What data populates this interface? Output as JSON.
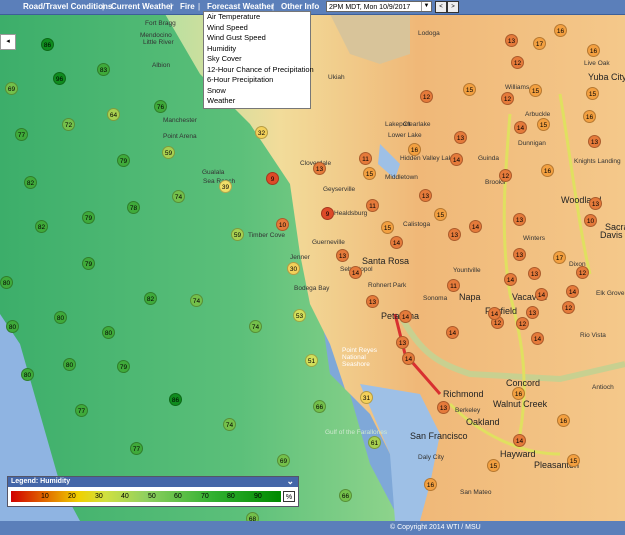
{
  "nav": {
    "items": [
      "Road/Travel Conditions",
      "Current Weather",
      "Fire",
      "Forecast Weather",
      "Other Info"
    ],
    "separator": "|"
  },
  "time_select": {
    "value": "2PM MDT, Mon 10/9/2017",
    "prev_label": "<",
    "next_label": ">"
  },
  "forecast_menu": {
    "items": [
      "Air Temperature",
      "Wind Speed",
      "Wind Gust Speed",
      "Humidity",
      "Sky Cover",
      "12-Hour Chance of Precipitation",
      "6-Hour Precipitation",
      "Snow",
      "Weather"
    ]
  },
  "map_button_label": "◂",
  "places": [
    "Fort Bragg",
    "Mendocino",
    "Little River",
    "Albion",
    "Manchester",
    "Point Arena",
    "Gualala",
    "Sea Ranch",
    "Timber Cove",
    "Jenner",
    "Bodega Bay",
    "Point Reyes National Seashore",
    "Gulf of the Farallones",
    "Cloverdale",
    "Geyserville",
    "Healdsburg",
    "Guerneville",
    "Santa Rosa",
    "Sebastopol",
    "Rohnert Park",
    "Petaluma",
    "Sonoma",
    "Napa",
    "Yountville",
    "Calistoga",
    "Middletown",
    "Lakeport",
    "Clearlake",
    "Lower Lake",
    "Hidden Valley Lake",
    "Ukiah",
    "Lodoga",
    "Williams",
    "Arbuckle",
    "Yuba City",
    "Live Oak",
    "Dunnigan",
    "Guinda",
    "Brooks",
    "Knights Landing",
    "Woodland",
    "Davis",
    "Winters",
    "Vacaville",
    "Dixon",
    "Fairfield",
    "Rio Vista",
    "Concord",
    "Walnut Creek",
    "Richmond",
    "Berkeley",
    "Oakland",
    "San Francisco",
    "Daly City",
    "Hayward",
    "Pleasanton",
    "San Mateo",
    "Sacramento",
    "Elk Grove",
    "Antioch"
  ],
  "markers": [
    {
      "v": "86"
    },
    {
      "v": "96"
    },
    {
      "v": "69"
    },
    {
      "v": "83"
    },
    {
      "v": "77"
    },
    {
      "v": "72"
    },
    {
      "v": "64"
    },
    {
      "v": "76"
    },
    {
      "v": "82"
    },
    {
      "v": "79"
    },
    {
      "v": "59"
    },
    {
      "v": "74"
    },
    {
      "v": "82"
    },
    {
      "v": "79"
    },
    {
      "v": "78"
    },
    {
      "v": "80"
    },
    {
      "v": "82"
    },
    {
      "v": "79"
    },
    {
      "v": "80"
    },
    {
      "v": "74"
    },
    {
      "v": "80"
    },
    {
      "v": "80"
    },
    {
      "v": "77"
    },
    {
      "v": "79"
    },
    {
      "v": "80"
    },
    {
      "v": "74"
    },
    {
      "v": "80"
    },
    {
      "v": "77"
    },
    {
      "v": "74"
    },
    {
      "v": "86"
    },
    {
      "v": "66"
    },
    {
      "v": "69"
    },
    {
      "v": "68"
    },
    {
      "v": "64"
    },
    {
      "v": "32"
    },
    {
      "v": "39"
    },
    {
      "v": "59"
    },
    {
      "v": "30"
    },
    {
      "v": "53"
    },
    {
      "v": "51"
    },
    {
      "v": "31"
    },
    {
      "v": "61"
    },
    {
      "v": "66"
    },
    {
      "v": "9"
    },
    {
      "v": "10"
    },
    {
      "v": "13"
    },
    {
      "v": "11"
    },
    {
      "v": "9"
    },
    {
      "v": "15"
    },
    {
      "v": "11"
    },
    {
      "v": "15"
    },
    {
      "v": "14"
    },
    {
      "v": "13"
    },
    {
      "v": "14"
    },
    {
      "v": "13"
    },
    {
      "v": "14"
    },
    {
      "v": "13"
    },
    {
      "v": "14"
    },
    {
      "v": "16"
    },
    {
      "v": "13"
    },
    {
      "v": "14"
    },
    {
      "v": "13"
    },
    {
      "v": "15"
    },
    {
      "v": "13"
    },
    {
      "v": "14"
    },
    {
      "v": "11"
    },
    {
      "v": "12"
    },
    {
      "v": "14"
    },
    {
      "v": "12"
    },
    {
      "v": "14"
    },
    {
      "v": "14"
    },
    {
      "v": "13"
    },
    {
      "v": "13"
    },
    {
      "v": "16"
    },
    {
      "v": "15"
    },
    {
      "v": "13"
    },
    {
      "v": "13"
    },
    {
      "v": "10"
    },
    {
      "v": "12"
    },
    {
      "v": "13"
    },
    {
      "v": "12"
    },
    {
      "v": "17"
    },
    {
      "v": "16"
    },
    {
      "v": "12"
    },
    {
      "v": "12"
    },
    {
      "v": "14"
    },
    {
      "v": "15"
    },
    {
      "v": "12"
    },
    {
      "v": "13"
    },
    {
      "v": "15"
    },
    {
      "v": "16"
    },
    {
      "v": "15"
    },
    {
      "v": "16"
    },
    {
      "v": "17"
    },
    {
      "v": "14"
    },
    {
      "v": "14"
    },
    {
      "v": "12"
    },
    {
      "v": "13"
    },
    {
      "v": "14"
    },
    {
      "v": "16"
    },
    {
      "v": "13"
    },
    {
      "v": "15"
    },
    {
      "v": "16"
    },
    {
      "v": "15"
    },
    {
      "v": "16"
    },
    {
      "v": "14"
    }
  ],
  "legend": {
    "title": "Legend: Humidity",
    "ticks": [
      "10",
      "20",
      "30",
      "40",
      "50",
      "60",
      "70",
      "80",
      "90"
    ],
    "unit": "%"
  },
  "footer": {
    "copyright": "© Copyright 2014 WTI / MSU"
  },
  "colors": {
    "nav_bar": "#5b7fba",
    "ocean": "#7fa8d8",
    "humidity_low": "#d10000",
    "humidity_high": "#008a00"
  }
}
